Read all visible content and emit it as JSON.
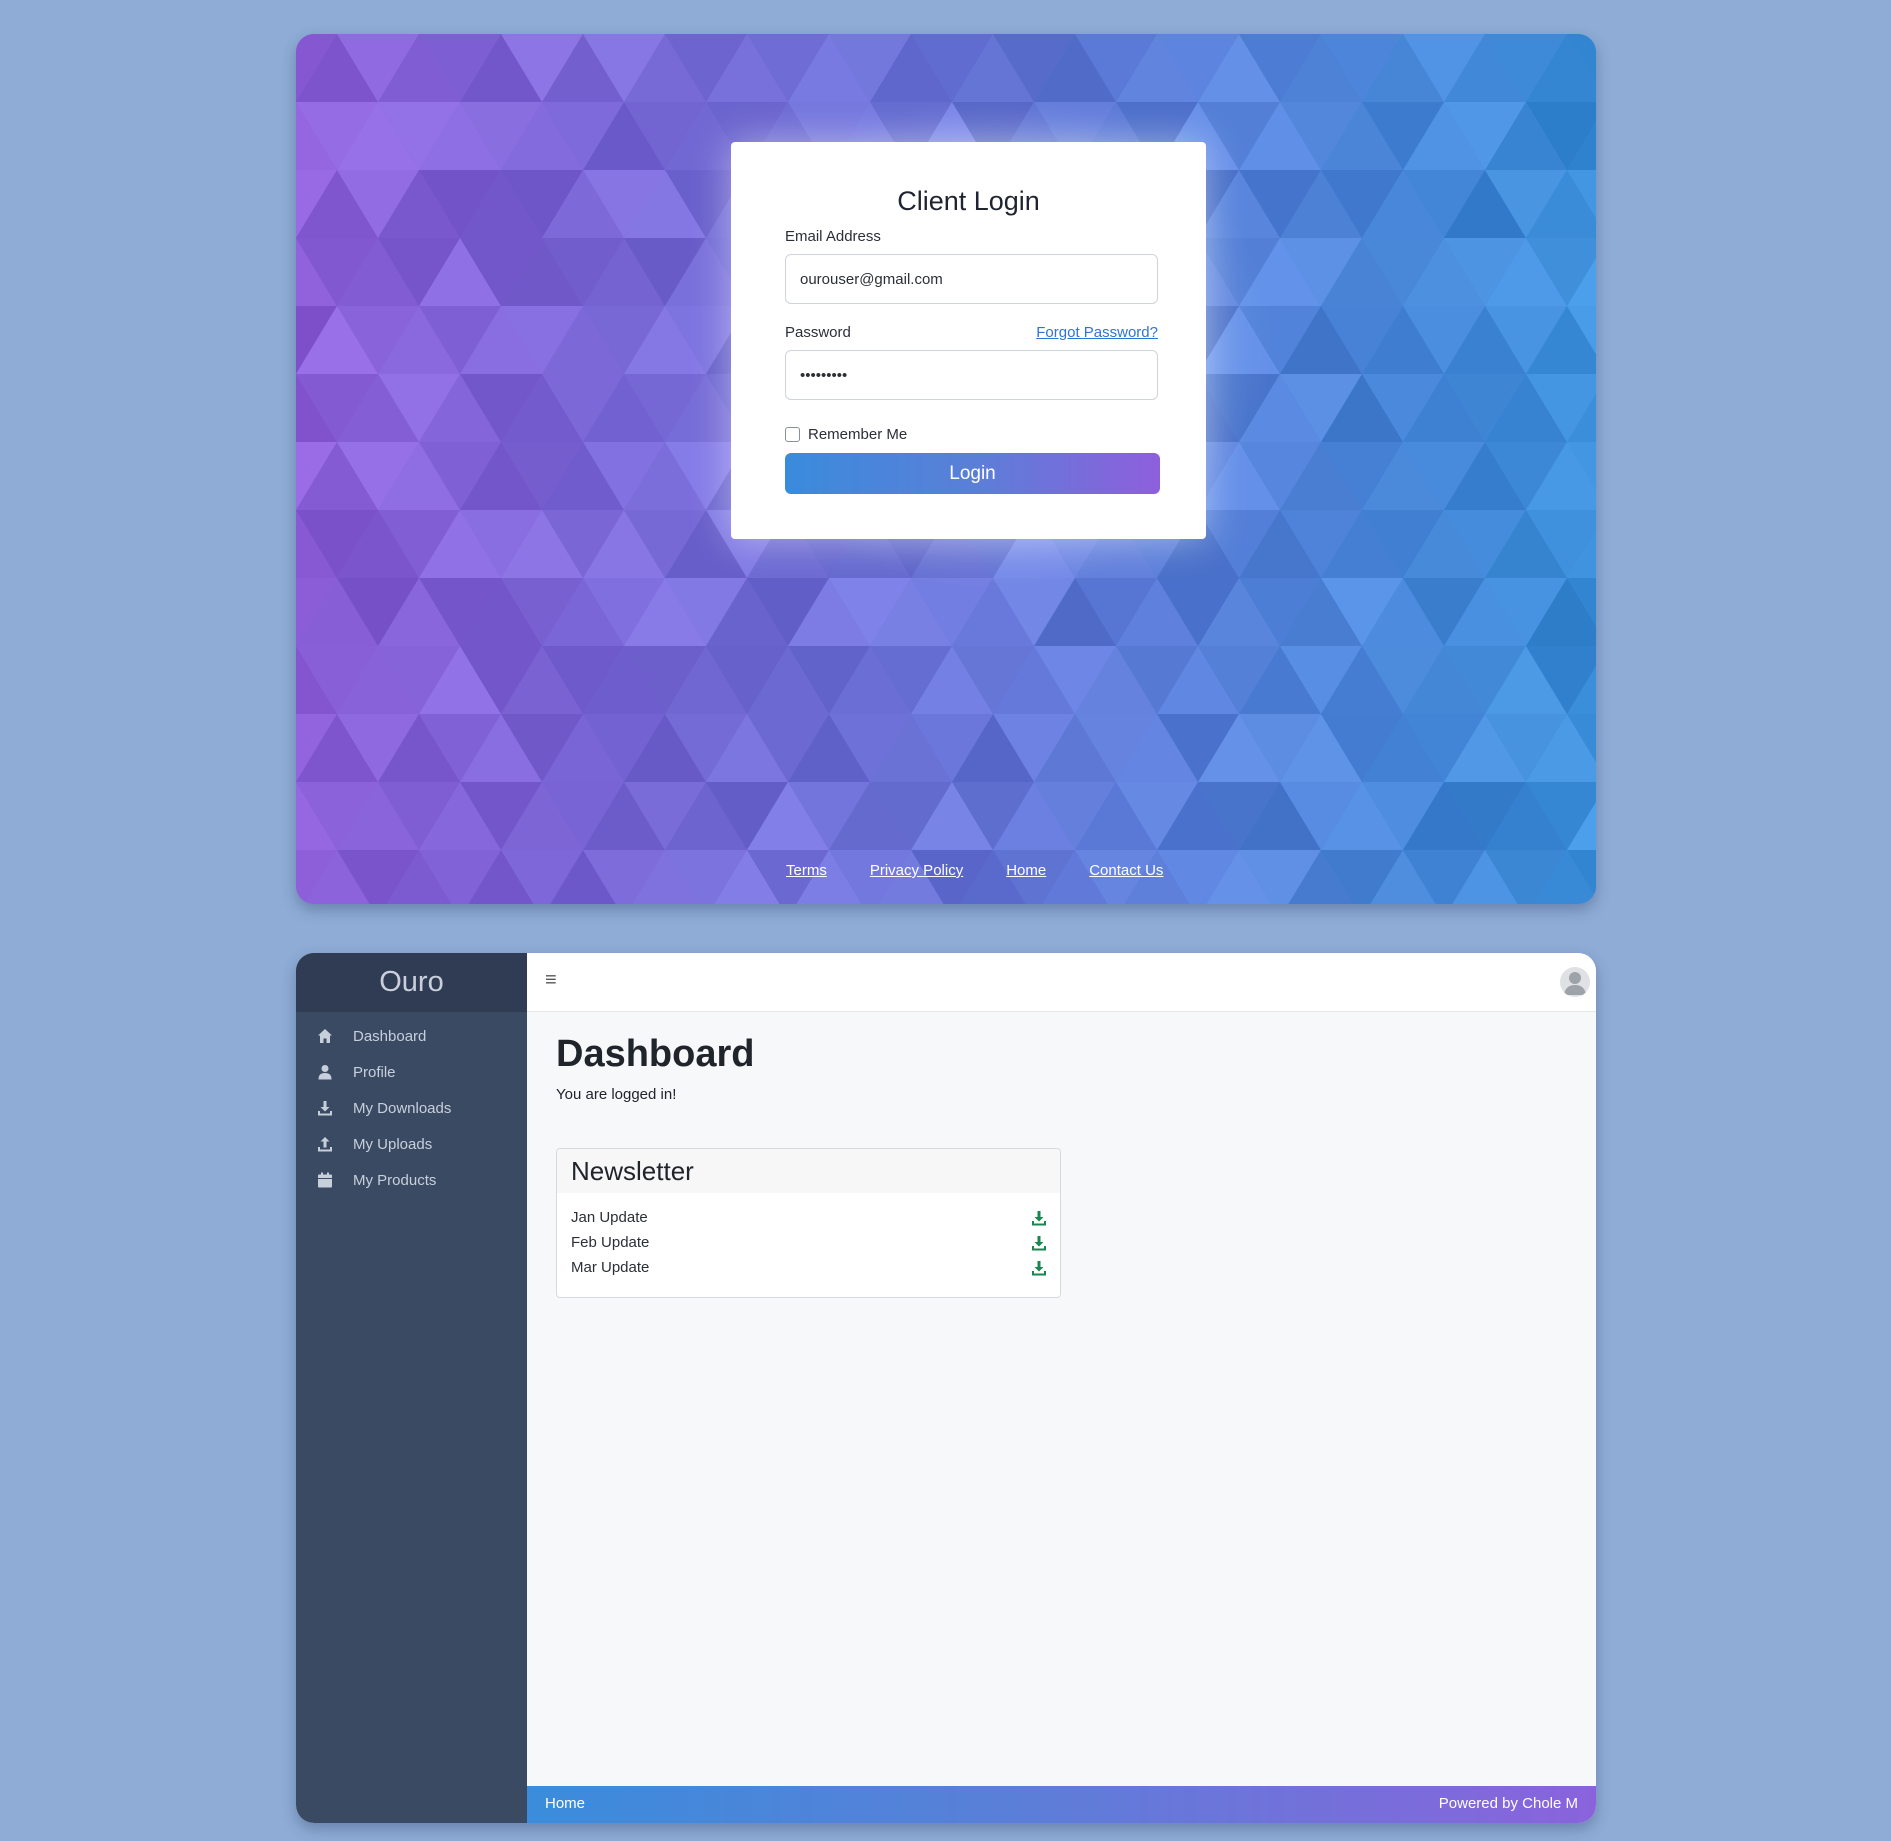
{
  "login": {
    "title": "Client Login",
    "email_label": "Email Address",
    "email_value": "ourouser@gmail.com",
    "password_label": "Password",
    "password_value": "password1",
    "forgot_label": "Forgot Password?",
    "remember_label": "Remember Me",
    "login_button": "Login",
    "footer_links": [
      "Terms",
      "Privacy Policy",
      "Home",
      "Contact Us"
    ]
  },
  "dashboard": {
    "brand": "Ouro",
    "nav": [
      {
        "label": "Dashboard",
        "icon": "home-icon"
      },
      {
        "label": "Profile",
        "icon": "user-icon"
      },
      {
        "label": "My Downloads",
        "icon": "download-icon"
      },
      {
        "label": "My Uploads",
        "icon": "upload-icon"
      },
      {
        "label": "My Products",
        "icon": "calendar-icon"
      }
    ],
    "title": "Dashboard",
    "subtitle": "You are logged in!",
    "newsletter": {
      "title": "Newsletter",
      "items": [
        "Jan Update",
        "Feb Update",
        "Mar Update"
      ]
    },
    "footer_home": "Home",
    "footer_powered": "Powered by Chole M"
  },
  "colors": {
    "page_bg": "#8eacd5",
    "sidebar": "#3b4a63",
    "accent_blue": "#3a8bdc",
    "accent_purple": "#8e5fdc",
    "download_green": "#19874f"
  }
}
